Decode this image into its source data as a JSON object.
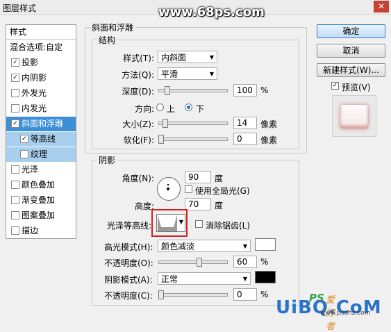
{
  "window": {
    "title": "图层样式",
    "close": "✕"
  },
  "watermark_top": "www.68ps.com",
  "sidebar": {
    "header": "样式",
    "items": [
      {
        "label": "混合选项:自定",
        "checkbox": false,
        "state": "plain"
      },
      {
        "label": "投影",
        "checkbox": true,
        "checked": "✓"
      },
      {
        "label": "内阴影",
        "checkbox": true,
        "checked": "✓"
      },
      {
        "label": "外发光",
        "checkbox": true,
        "checked": ""
      },
      {
        "label": "内发光",
        "checkbox": true,
        "checked": ""
      },
      {
        "label": "斜面和浮雕",
        "checkbox": true,
        "checked": "✓",
        "state": "selected"
      },
      {
        "label": "等高线",
        "checkbox": true,
        "checked": "✓",
        "state": "sub"
      },
      {
        "label": "纹理",
        "checkbox": true,
        "checked": "",
        "state": "sub"
      },
      {
        "label": "光泽",
        "checkbox": true,
        "checked": ""
      },
      {
        "label": "颜色叠加",
        "checkbox": true,
        "checked": ""
      },
      {
        "label": "渐变叠加",
        "checkbox": true,
        "checked": ""
      },
      {
        "label": "图案叠加",
        "checkbox": true,
        "checked": ""
      },
      {
        "label": "描边",
        "checkbox": true,
        "checked": ""
      }
    ]
  },
  "bevel": {
    "group_title": "斜面和浮雕",
    "structure_title": "结构",
    "style_label": "样式(T):",
    "style_value": "内斜面",
    "technique_label": "方法(Q):",
    "technique_value": "平滑",
    "depth_label": "深度(D):",
    "depth_value": "100",
    "depth_unit": "%",
    "direction_label": "方向:",
    "direction_up": "上",
    "direction_down": "下",
    "size_label": "大小(Z):",
    "size_value": "14",
    "size_unit": "像素",
    "soften_label": "软化(F):",
    "soften_value": "0",
    "soften_unit": "像素"
  },
  "shading": {
    "title": "阴影",
    "angle_label": "角度(N):",
    "angle_value": "90",
    "angle_unit": "度",
    "global_light_label": "使用全局光(G)",
    "altitude_label": "高度:",
    "altitude_value": "70",
    "altitude_unit": "度",
    "gloss_contour_label": "光泽等高线:",
    "antialias_label": "消除锯齿(L)",
    "highlight_mode_label": "高光模式(H):",
    "highlight_mode_value": "颜色减淡",
    "highlight_color": "#ffffff",
    "highlight_opacity_label": "不透明度(O):",
    "highlight_opacity_value": "60",
    "highlight_opacity_unit": "%",
    "shadow_mode_label": "阴影模式(A):",
    "shadow_mode_value": "正常",
    "shadow_color": "#000000",
    "shadow_opacity_label": "不透明度(C):",
    "shadow_opacity_value": "0",
    "shadow_opacity_unit": "%"
  },
  "buttons": {
    "ok": "确定",
    "cancel": "取消",
    "new_style": "新建样式(W)...",
    "preview_label": "预览(V)",
    "preview_check": "✓"
  },
  "sliders": {
    "depth_level": 0.1,
    "size_level": 0.06,
    "soften_level": 0,
    "highlight_opacity_level": 0.6,
    "shadow_opacity_level": 0
  },
  "footer_watermark": {
    "ps": "PS",
    "site": "爱好者",
    "brand": "UiBQ.CoM",
    "url": "www.psahz.com"
  },
  "colors": {
    "accent": "#3d8fd8",
    "highlight_box": "#d42020"
  }
}
